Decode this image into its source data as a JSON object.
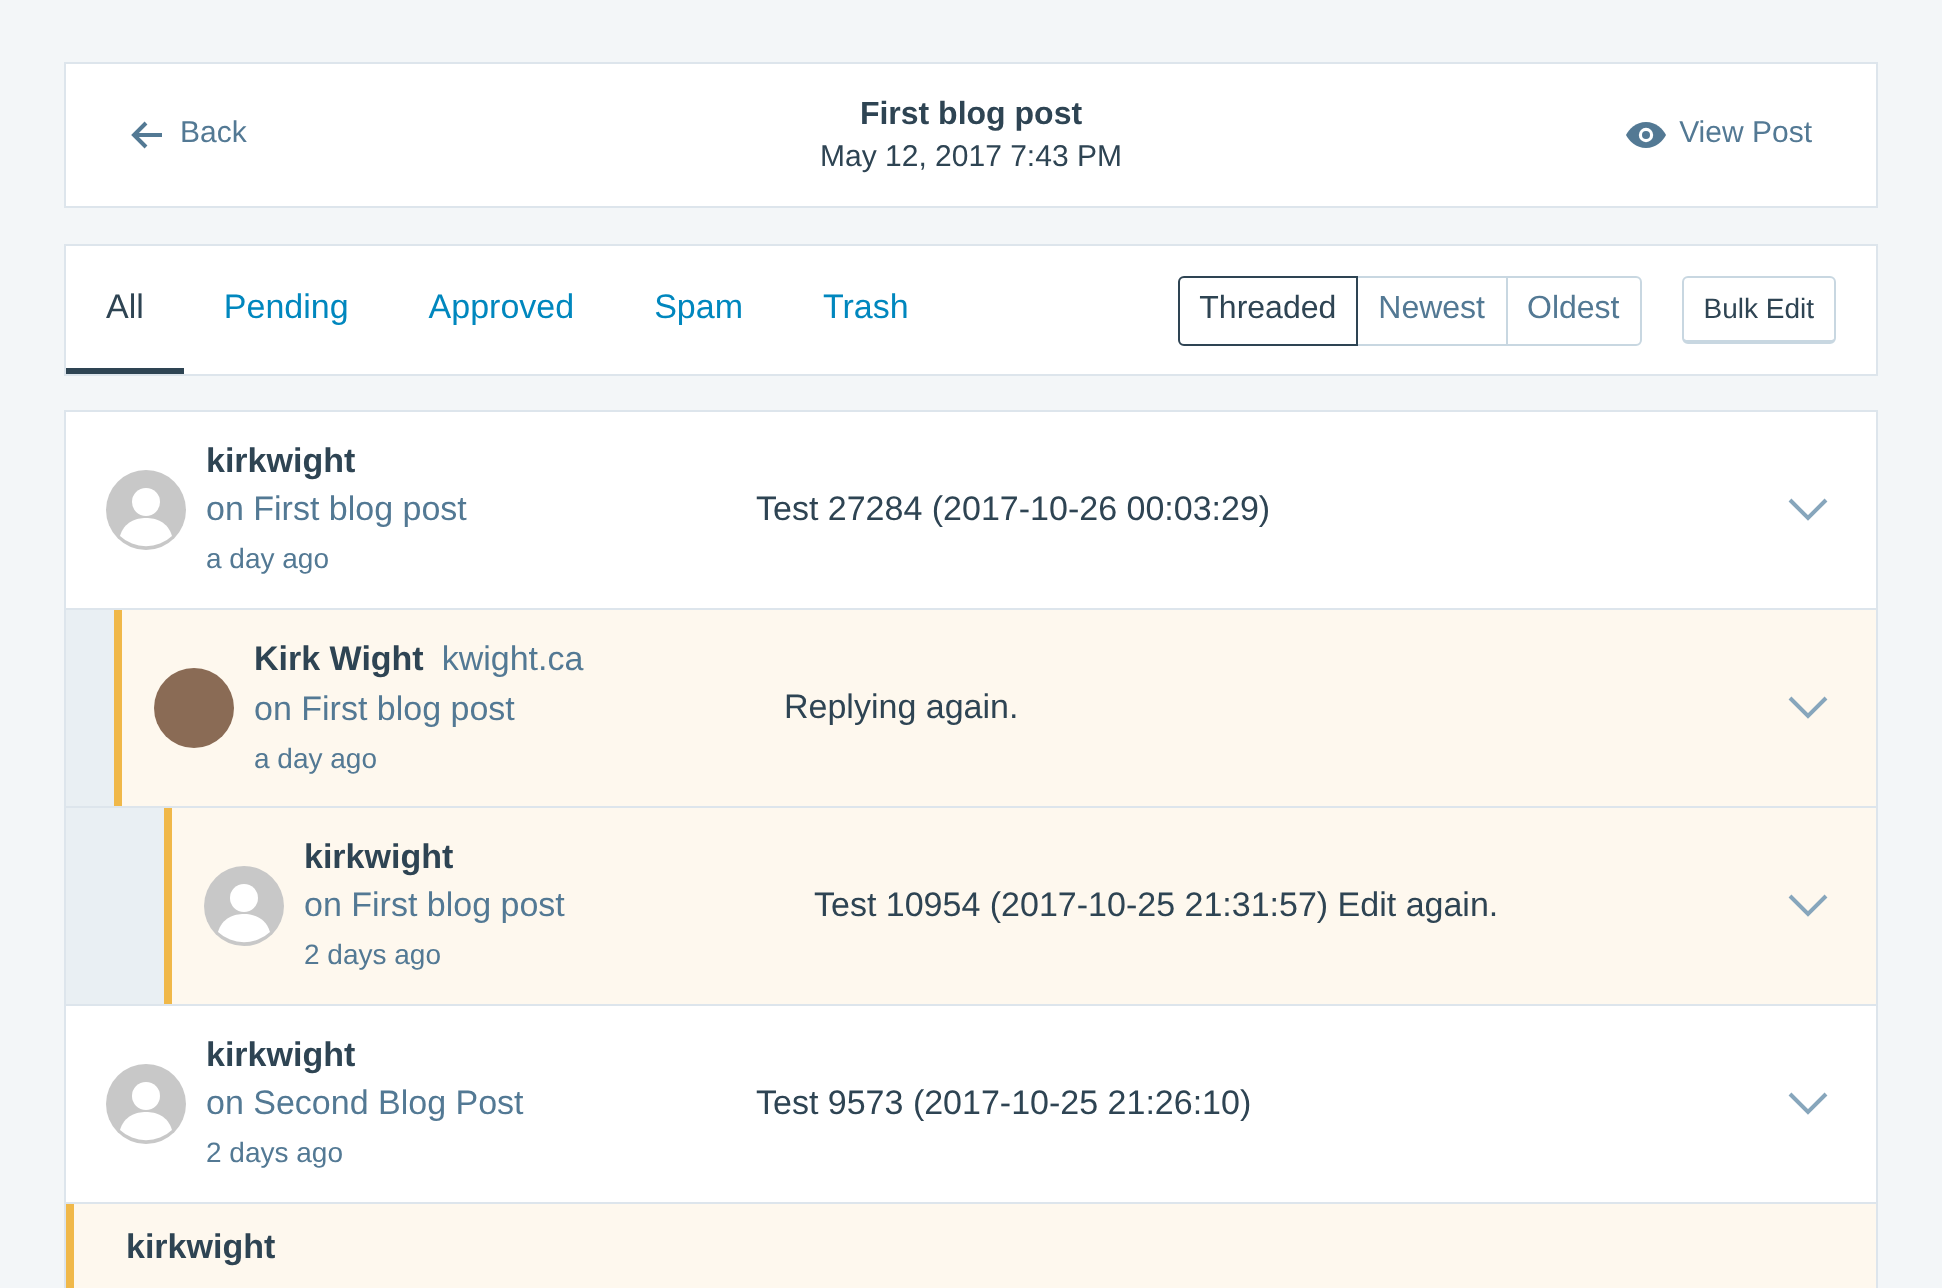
{
  "header": {
    "back": "Back",
    "title": "First blog post",
    "date": "May 12, 2017 7:43 PM",
    "view_post": "View Post"
  },
  "tabs": [
    {
      "label": "All",
      "selected": true
    },
    {
      "label": "Pending",
      "selected": false
    },
    {
      "label": "Approved",
      "selected": false
    },
    {
      "label": "Spam",
      "selected": false
    },
    {
      "label": "Trash",
      "selected": false
    }
  ],
  "sort": [
    {
      "label": "Threaded",
      "selected": true
    },
    {
      "label": "Newest",
      "selected": false
    },
    {
      "label": "Oldest",
      "selected": false
    }
  ],
  "bulk_edit": "Bulk Edit",
  "comments": [
    {
      "author": "kirkwight",
      "kind": "default",
      "post": "on First blog post",
      "time": "a day ago",
      "text": "Test 27284 (2017-10-26 00:03:29)",
      "pending": false,
      "children": [
        {
          "author": "Kirk Wight",
          "site": "kwight.ca",
          "kind": "photo",
          "post": "on First blog post",
          "time": "a day ago",
          "text": "Replying again.",
          "pending": true,
          "children": [
            {
              "author": "kirkwight",
              "kind": "default",
              "post": "on First blog post",
              "time": "2 days ago",
              "text": "Test 10954 (2017-10-25 21:31:57) Edit again.",
              "pending": true
            }
          ]
        }
      ]
    },
    {
      "author": "kirkwight",
      "kind": "default",
      "post": "on Second Blog Post",
      "time": "2 days ago",
      "text": "Test 9573 (2017-10-25 21:26:10)",
      "pending": false
    },
    {
      "author": "kirkwight",
      "pending": true
    }
  ]
}
